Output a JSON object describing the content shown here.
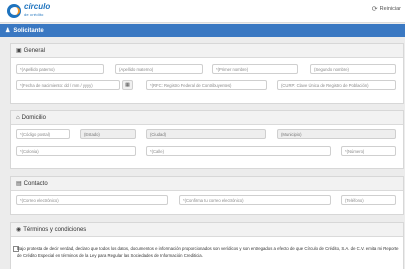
{
  "logo": {
    "line1": "círculo",
    "line2": "de crédito"
  },
  "topbar": {
    "refresh_label": "Reiniciar"
  },
  "section": {
    "title": "Solicitante"
  },
  "general": {
    "title": "General",
    "nombre": "*(Apellido paterno)",
    "ap_materno": "(Apellido materno)",
    "primer_nombre": "*(Primer nombre)",
    "segundo_nombre": "(Segundo nombre)",
    "fecha_nac": "*(Fecha de nacimiento: dd / mm / yyyy)",
    "rfc": "*(RFC: Registro Federal de Contribuyentes)",
    "curp": "(CURP: Clave Única de Registro de Población)"
  },
  "domicilio": {
    "title": "Domicilio",
    "cp": "*(Código postal)",
    "estado": "(Estado)",
    "ciudad": "(Ciudad)",
    "municipio": "(Municipio)",
    "colonia": "*(Colonia)",
    "calle": "*(Calle)",
    "numero": "*(Número)"
  },
  "contacto": {
    "title": "Contacto",
    "correo": "*(Correo electrónico)",
    "confirma_correo": "*(Confirma tu correo electrónico)",
    "telefono": "(Teléfono)"
  },
  "terminos": {
    "title": "Términos y condiciones",
    "text": "Bajo protesta de decir verdad, declaro que todos los datos, documentos e información proporcionados son verídicos y son entregados a efecto de que Círculo de Crédito, S.A. de C.V. emita mi Reporte de Crédito Especial en términos de la Ley para Regular las Sociedades de Información Crediticia."
  }
}
